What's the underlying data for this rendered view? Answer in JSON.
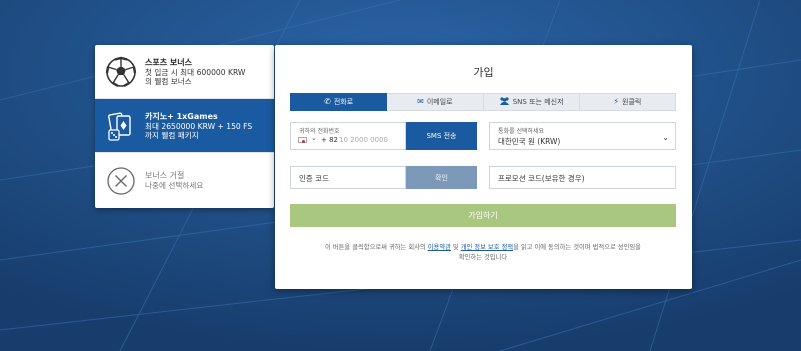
{
  "colors": {
    "background": "#1f4e86",
    "accent": "#1a5aa0",
    "signup_button": "#a9c77e",
    "confirm_button": "#7d99b9"
  },
  "bonus_panel": {
    "items": [
      {
        "icon": "soccer-ball-icon",
        "title": "스포츠 보너스",
        "desc_line1": "첫 입금 시 최대 600000 KRW",
        "desc_line2": "의 웰컴 보너스",
        "active": false
      },
      {
        "icon": "casino-cards-icon",
        "title": "카지노+ 1xGames",
        "desc_line1": "최대 2650000 KRW + 150 FS",
        "desc_line2": "까지 웰컴 패키지",
        "active": true
      },
      {
        "icon": "close-circle-icon",
        "title": "보너스 거절",
        "desc_line1": "나중에 선택하세요",
        "desc_line2": "",
        "active": false
      }
    ]
  },
  "registration": {
    "title": "가입",
    "tabs": [
      {
        "icon": "phone-icon",
        "label": "전화로",
        "active": true
      },
      {
        "icon": "envelope-icon",
        "label": "이메일로",
        "active": false
      },
      {
        "icon": "users-icon",
        "label": "SNS 또는 메신저",
        "active": false
      },
      {
        "icon": "lightning-icon",
        "label": "원클릭",
        "active": false
      }
    ],
    "phone": {
      "label": "귀하의 전화번호",
      "country_code": "+ 82",
      "placeholder": "10 2000 0000"
    },
    "sms_button": "SMS 전송",
    "currency": {
      "label": "통화를 선택하세요",
      "value": "대한민국 원 (KRW)"
    },
    "code": {
      "placeholder": "인증 코드"
    },
    "confirm_button": "확인",
    "promo": {
      "placeholder": "프로모션 코드(보유한 경우)"
    },
    "signup_button": "가입하기",
    "terms": {
      "before": "이 버튼을 클릭함으로써 귀하는 회사의 ",
      "link1": "이용약관",
      "between": " 및 ",
      "link2": "개인 정보 보호 정책",
      "after_line1": "을 읽고 이에 동의하는 것이며 법적으로 성인임을",
      "line2": "확인하는 것입니다"
    }
  }
}
